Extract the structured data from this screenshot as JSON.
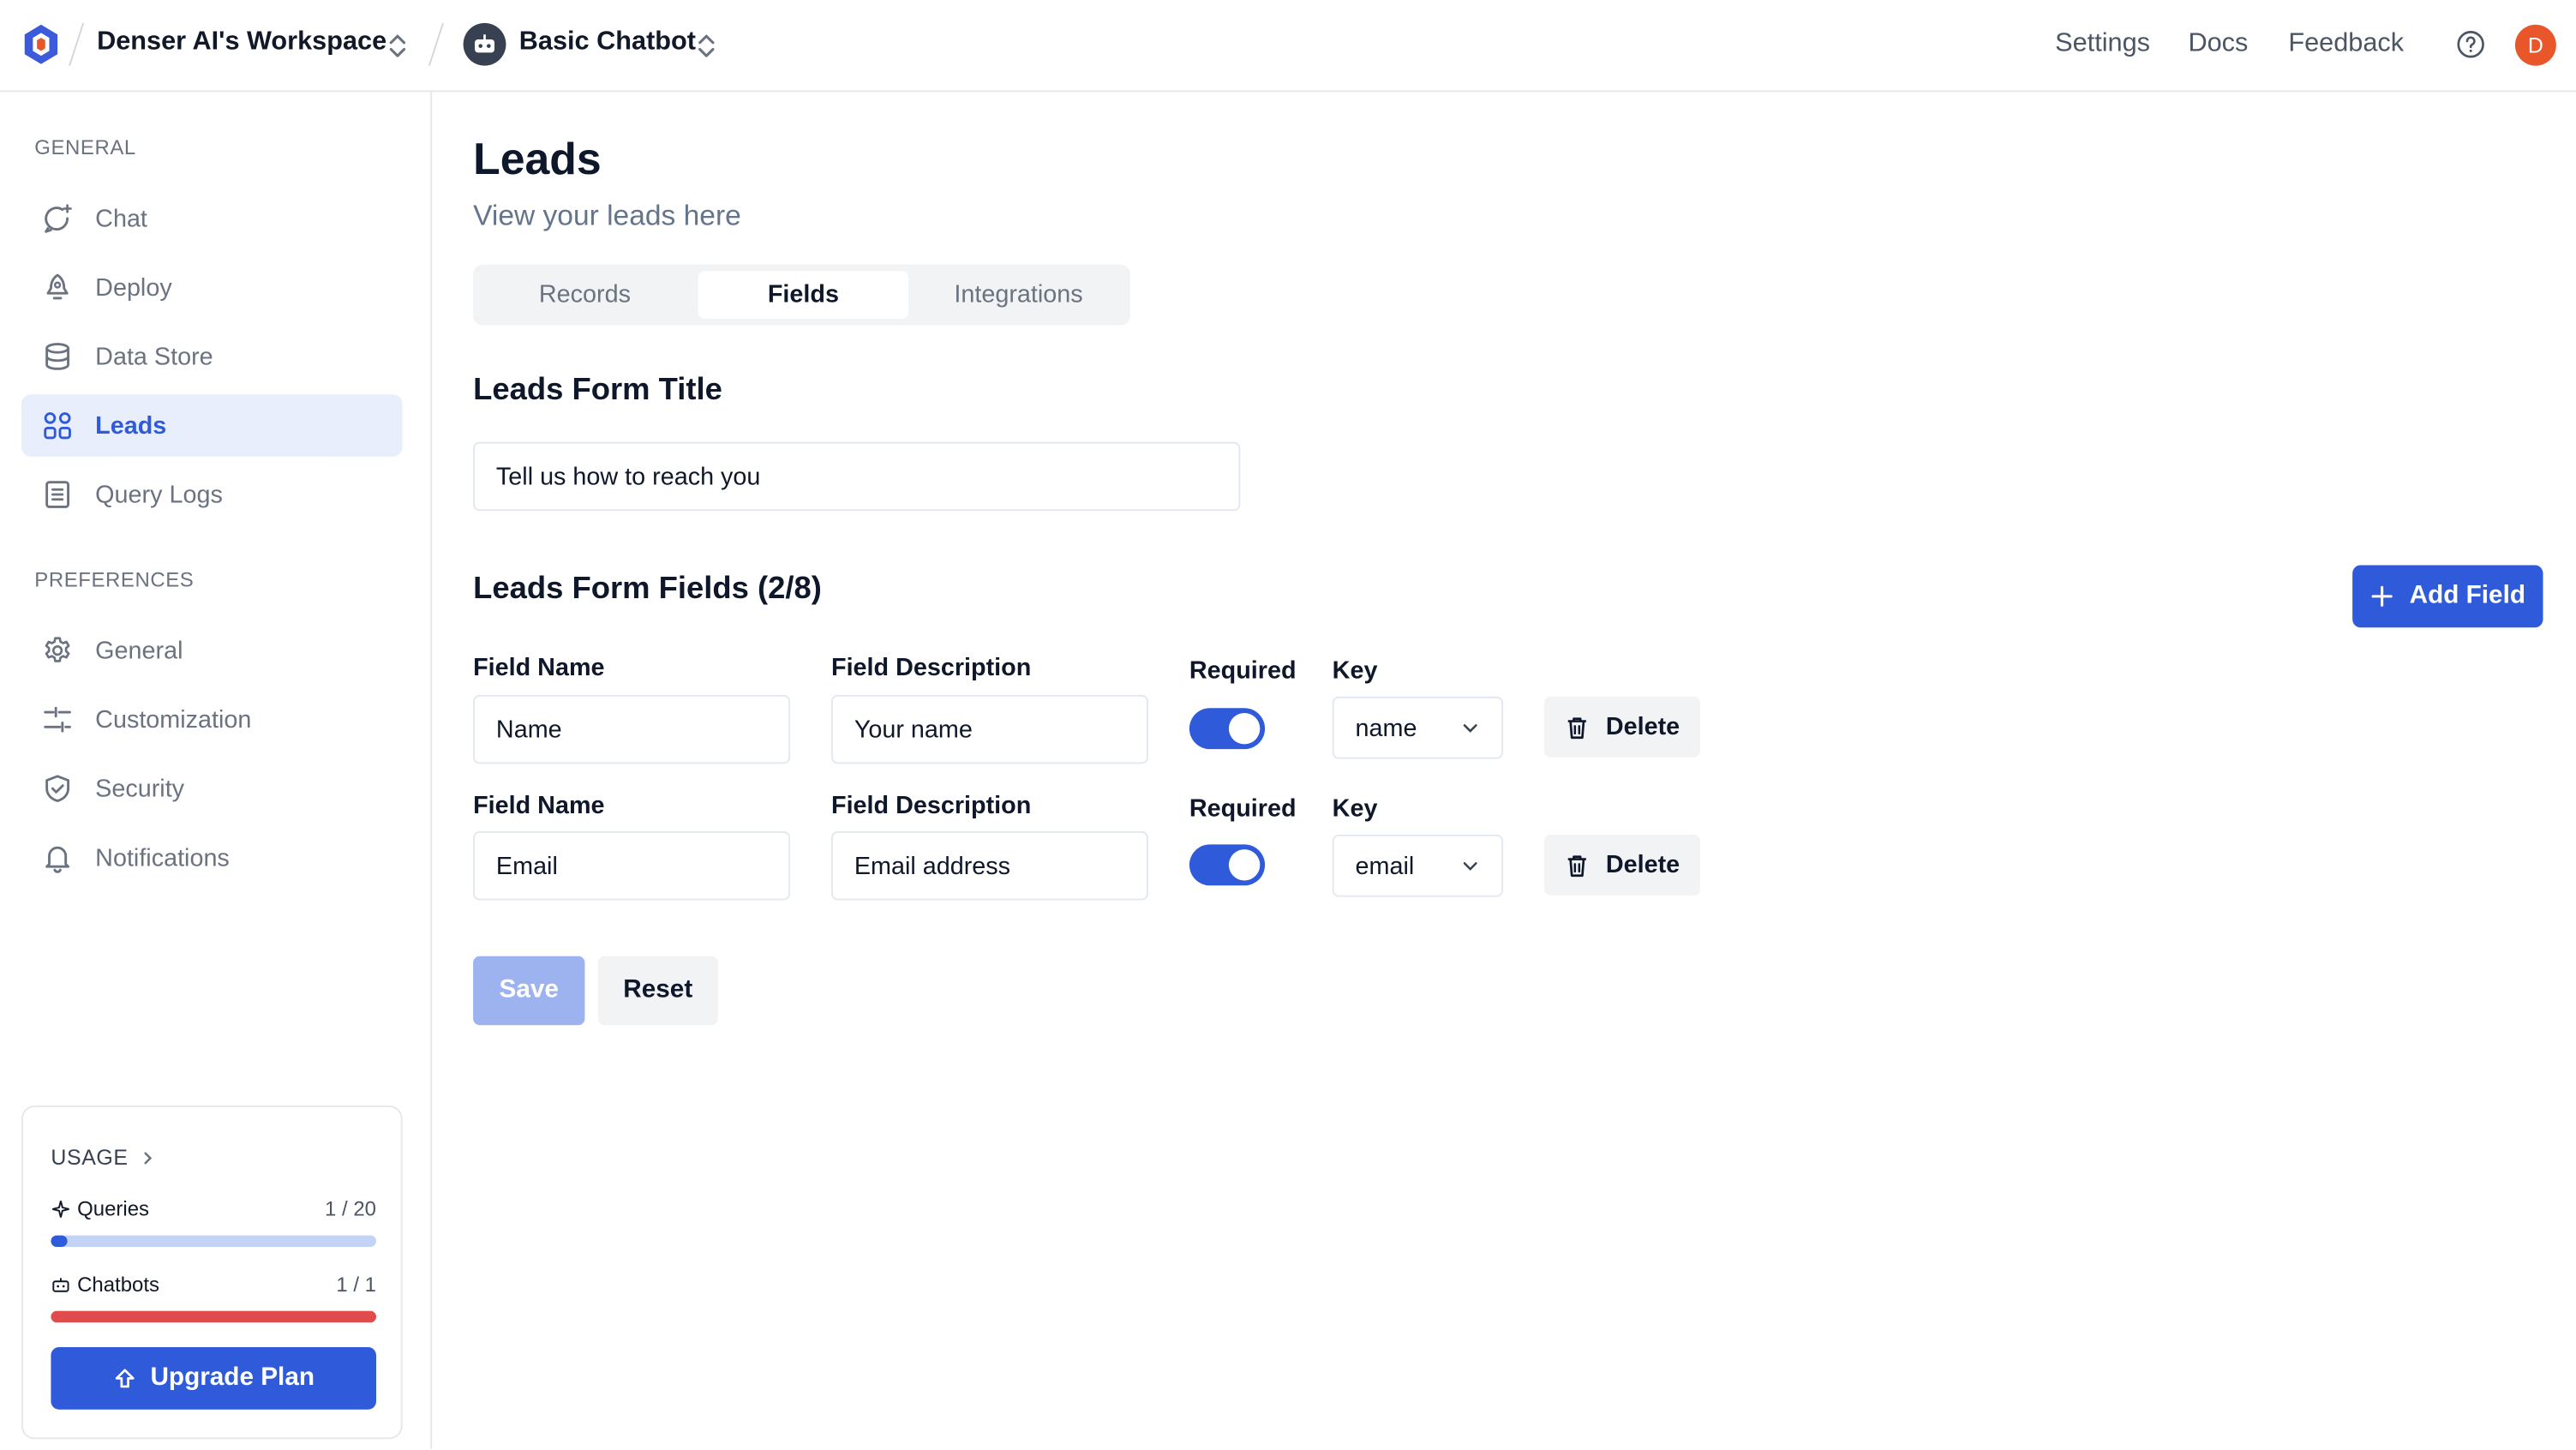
{
  "topbar": {
    "workspace_name": "Denser AI's Workspace",
    "chatbot_name": "Basic Chatbot",
    "links": {
      "settings": "Settings",
      "docs": "Docs",
      "feedback": "Feedback"
    },
    "user_initial": "D",
    "logo_icon": "denser-logo-icon",
    "help_icon": "help-circle-icon"
  },
  "sidebar": {
    "general_label": "GENERAL",
    "preferences_label": "PREFERENCES",
    "general_items": [
      {
        "label": "Chat",
        "icon": "chat-icon"
      },
      {
        "label": "Deploy",
        "icon": "rocket-icon"
      },
      {
        "label": "Data Store",
        "icon": "database-icon"
      },
      {
        "label": "Leads",
        "icon": "leads-icon",
        "active": true
      },
      {
        "label": "Query Logs",
        "icon": "logs-icon"
      }
    ],
    "preference_items": [
      {
        "label": "General",
        "icon": "gear-icon"
      },
      {
        "label": "Customization",
        "icon": "sliders-icon"
      },
      {
        "label": "Security",
        "icon": "shield-icon"
      },
      {
        "label": "Notifications",
        "icon": "bell-icon"
      }
    ],
    "usage": {
      "title": "USAGE",
      "queries": {
        "label": "Queries",
        "count": "1 / 20",
        "fraction": 0.05,
        "color": "#2f5bdb",
        "track": "#c3d3f5"
      },
      "chatbots": {
        "label": "Chatbots",
        "count": "1 / 1",
        "fraction": 1.0,
        "color": "#e04b4b",
        "track": "#f5c6c6"
      },
      "upgrade_label": "Upgrade Plan"
    }
  },
  "main": {
    "title": "Leads",
    "subtitle": "View your leads here",
    "tabs": [
      {
        "label": "Records"
      },
      {
        "label": "Fields",
        "active": true
      },
      {
        "label": "Integrations"
      }
    ],
    "form_title_heading": "Leads Form Title",
    "form_title_value": "Tell us how to reach you",
    "fields_heading": "Leads Form Fields (2/8)",
    "add_field_label": "Add Field",
    "labels": {
      "field_name": "Field Name",
      "field_description": "Field Description",
      "required": "Required",
      "key": "Key",
      "delete": "Delete"
    },
    "fields": [
      {
        "name": "Name",
        "description": "Your name",
        "required": true,
        "key": "name"
      },
      {
        "name": "Email",
        "description": "Email address",
        "required": true,
        "key": "email"
      }
    ],
    "save_label": "Save",
    "reset_label": "Reset"
  },
  "colors": {
    "accent": "#2f5bdb",
    "active_bg": "#e8eefb",
    "avatar": "#e8562a"
  }
}
